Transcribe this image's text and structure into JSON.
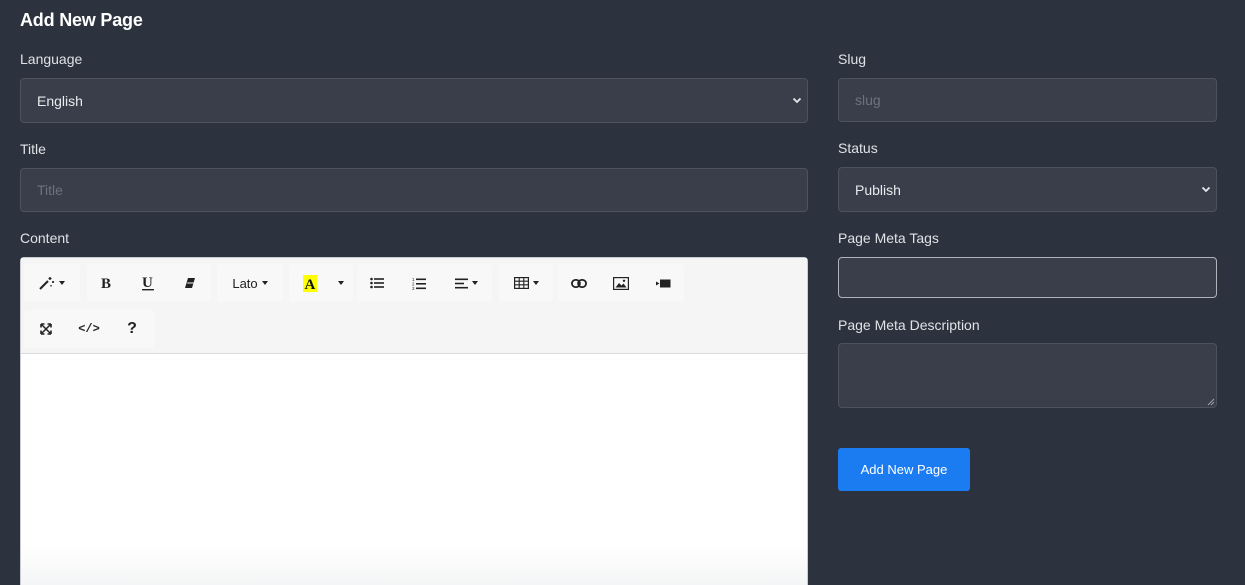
{
  "page": {
    "title": "Add New Page"
  },
  "form": {
    "language": {
      "label": "Language",
      "value": "English"
    },
    "title": {
      "label": "Title",
      "placeholder": "Title",
      "value": ""
    },
    "content": {
      "label": "Content"
    },
    "slug": {
      "label": "Slug",
      "placeholder": "slug",
      "value": ""
    },
    "status": {
      "label": "Status",
      "value": "Publish"
    },
    "meta_tags": {
      "label": "Page Meta Tags",
      "value": ""
    },
    "meta_description": {
      "label": "Page Meta Description",
      "value": ""
    },
    "submit_label": "Add New Page"
  },
  "editor": {
    "font_name": "Lato",
    "help_label": "?",
    "code_label": "</>",
    "toolbar_icons": [
      "magic-wand-icon",
      "bold-icon",
      "underline-icon",
      "eraser-icon",
      "font-family-dropdown",
      "text-color-icon",
      "color-dropdown-icon",
      "unordered-list-icon",
      "ordered-list-icon",
      "align-icon",
      "table-icon",
      "link-icon",
      "image-icon",
      "video-icon",
      "fullscreen-icon",
      "code-view-icon",
      "help-icon"
    ]
  },
  "colors": {
    "background": "#2d333e",
    "field_bg": "#393e4a",
    "primary_button": "#1a7cf0",
    "highlight": "#ffff00"
  }
}
